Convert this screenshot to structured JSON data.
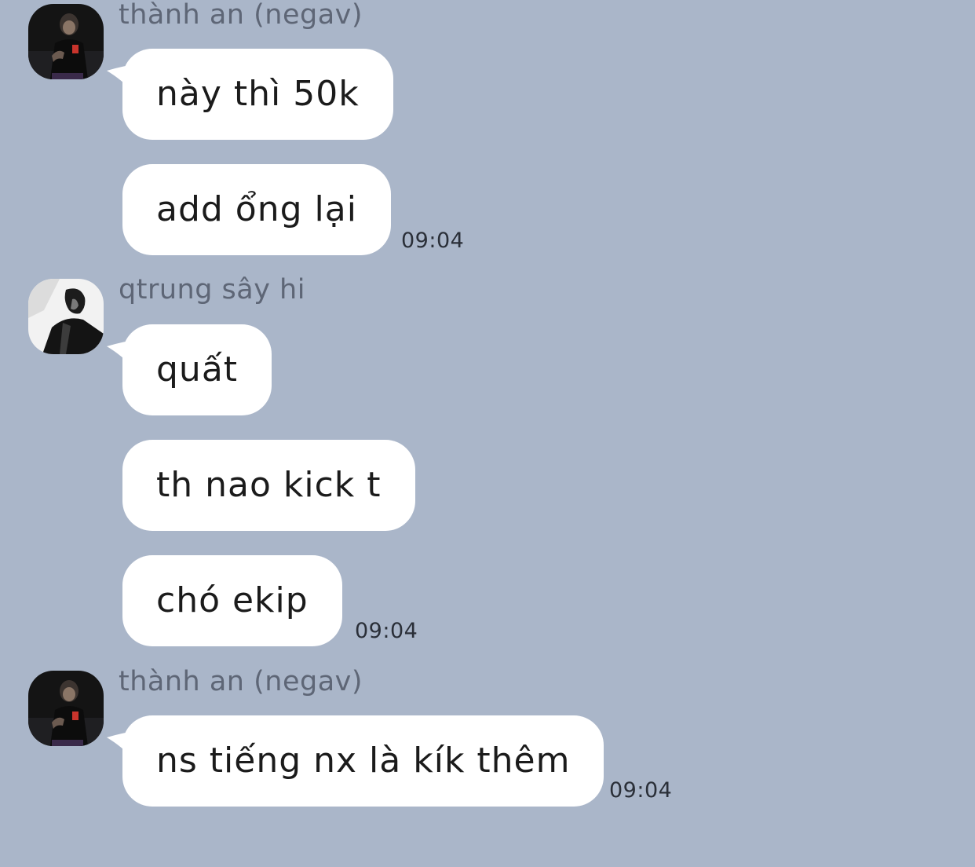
{
  "colors": {
    "background": "#aab6c9",
    "bubble": "#ffffff",
    "sender_name": "#5e6676",
    "message_text": "#1b1b1b",
    "timestamp": "#2a2f38"
  },
  "messages": [
    {
      "sender": "thành an (negav)",
      "avatar": "avatar-photo-dark-portrait",
      "bubbles": [
        "này thì 50k",
        "add ổng lại"
      ],
      "time": "09:04"
    },
    {
      "sender": "qtrung sây hi",
      "avatar": "avatar-photo-black-white-profile",
      "bubbles": [
        "quất",
        "th nao kick t",
        "chó ekip"
      ],
      "time": "09:04"
    },
    {
      "sender": "thành an (negav)",
      "avatar": "avatar-photo-dark-portrait",
      "bubbles": [
        "ns tiếng nx là kík thêm"
      ],
      "time": "09:04"
    }
  ]
}
